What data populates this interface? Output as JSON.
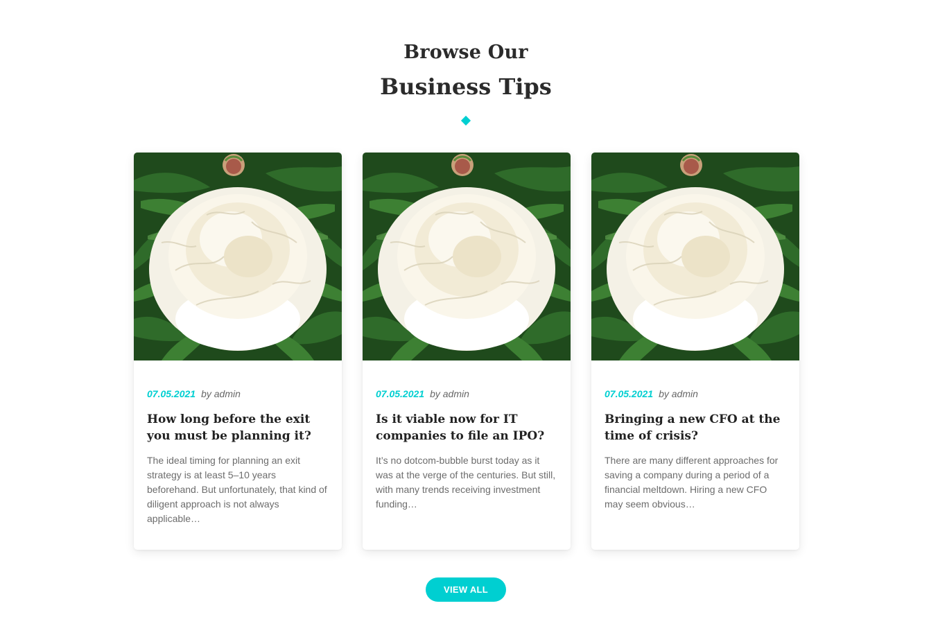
{
  "header": {
    "title_line1": "Browse Our",
    "title_line2": "Business Tips"
  },
  "colors": {
    "accent": "#00cfd1"
  },
  "posts": [
    {
      "date": "07.05.2021",
      "author": "by admin",
      "title": "How long before the exit you must be planning it?",
      "excerpt": "The ideal timing for planning an exit strategy is at least 5–10 years beforehand. But unfortunately, that kind of diligent approach is not always applicable…",
      "image": "white-peony-photo"
    },
    {
      "date": "07.05.2021",
      "author": "by admin",
      "title": "Is it viable now for IT companies to file an IPO?",
      "excerpt": "It’s no dotcom-bubble burst today as it was at the verge of the centuries. But still, with many trends receiving investment funding…",
      "image": "white-peony-photo"
    },
    {
      "date": "07.05.2021",
      "author": "by admin",
      "title": "Bringing a new CFO at the time of crisis?",
      "excerpt": "There are many different approaches for saving a company during a period of a financial meltdown. Hiring a new CFO may seem obvious…",
      "image": "white-peony-photo"
    }
  ],
  "footer": {
    "view_all_label": "VIEW ALL"
  }
}
